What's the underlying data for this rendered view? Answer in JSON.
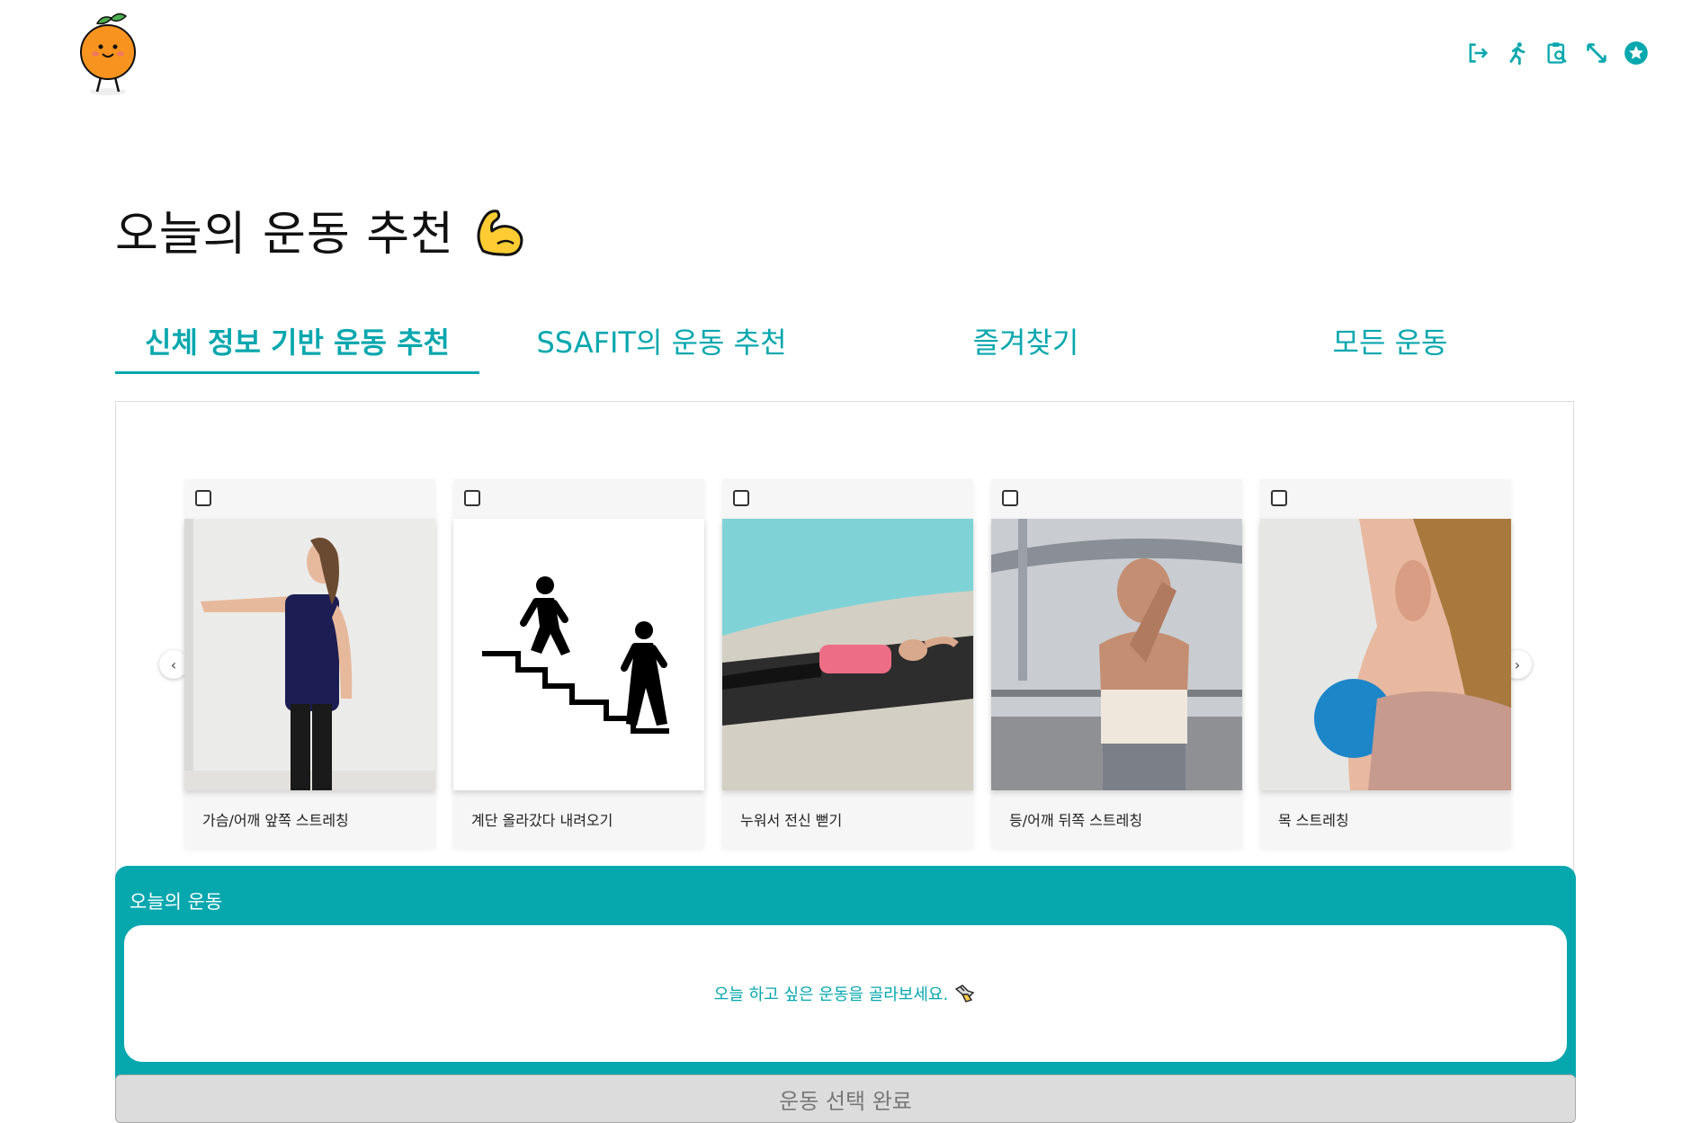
{
  "header": {
    "logo_name": "orange-mascot-logo",
    "icons": [
      "logout-icon",
      "running-icon",
      "clipboard-search-icon",
      "resize-icon",
      "star-badge-icon"
    ],
    "accent_color": "#07a7ae"
  },
  "page_title": "오늘의 운동 추천",
  "title_emoji": "💪",
  "tabs": [
    {
      "label": "신체 정보 기반 운동 추천",
      "active": true
    },
    {
      "label": "SSAFIT의 운동 추천",
      "active": false
    },
    {
      "label": "즐겨찾기",
      "active": false
    },
    {
      "label": "모든 운동",
      "active": false
    }
  ],
  "carousel": {
    "prev_label": "‹",
    "next_label": "›",
    "cards": [
      {
        "label": "가슴/어깨 앞쪽 스트레칭",
        "checked": false
      },
      {
        "label": "계단 올라갔다 내려오기",
        "checked": false
      },
      {
        "label": "누워서 전신 뻗기",
        "checked": false
      },
      {
        "label": "등/어깨 뒤쪽 스트레칭",
        "checked": false
      },
      {
        "label": "목 스트레칭",
        "checked": false
      }
    ]
  },
  "today": {
    "title": "오늘의 운동",
    "message": "오늘 하고 싶은 운동을 골라보세요."
  },
  "complete_button": "운동 선택 완료"
}
